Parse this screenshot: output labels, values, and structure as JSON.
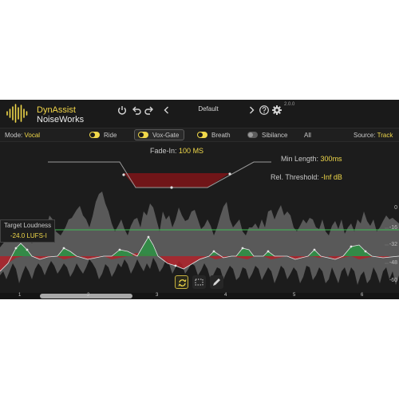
{
  "header": {
    "brand_name": "DynAssist",
    "product_name": "NoiseWorks",
    "preset": "Default",
    "version": "2.0.0",
    "icons": [
      "power-icon",
      "undo-icon",
      "redo-icon",
      "chevron-left-icon",
      "chevron-right-icon",
      "help-icon",
      "gear-icon"
    ]
  },
  "tabbar": {
    "mode_label": "Mode:",
    "mode_value": "Vocal",
    "tabs": [
      {
        "label": "Ride",
        "enabled": true,
        "selected": false
      },
      {
        "label": "Vox-Gate",
        "enabled": true,
        "selected": true
      },
      {
        "label": "Breath",
        "enabled": true,
        "selected": false
      },
      {
        "label": "Sibilance",
        "enabled": false,
        "selected": false
      }
    ],
    "all_label": "All",
    "source_label": "Source:",
    "source_value": "Track"
  },
  "gate": {
    "fade_label": "Fade-In:",
    "fade_value": "100 MS",
    "min_length_label": "Min Length:",
    "min_length_value": "300ms",
    "threshold_label": "Rel. Threshold:",
    "threshold_value": "-Inf dB"
  },
  "target": {
    "label": "Target Loudness",
    "value": "-24.0 LUFS-I"
  },
  "db_scale": [
    "0",
    "-16",
    "-32",
    "-48",
    "-60"
  ],
  "tools": [
    "loop-icon",
    "selection-icon",
    "pencil-icon"
  ],
  "ruler": [
    "1",
    "2",
    "3",
    "4",
    "5",
    "6"
  ],
  "colors": {
    "accent": "#f0d84a",
    "boost": "#2f8f45",
    "cut": "#c0282e",
    "target_line": "#3fbf55",
    "waveform": "#5a5a5a"
  }
}
